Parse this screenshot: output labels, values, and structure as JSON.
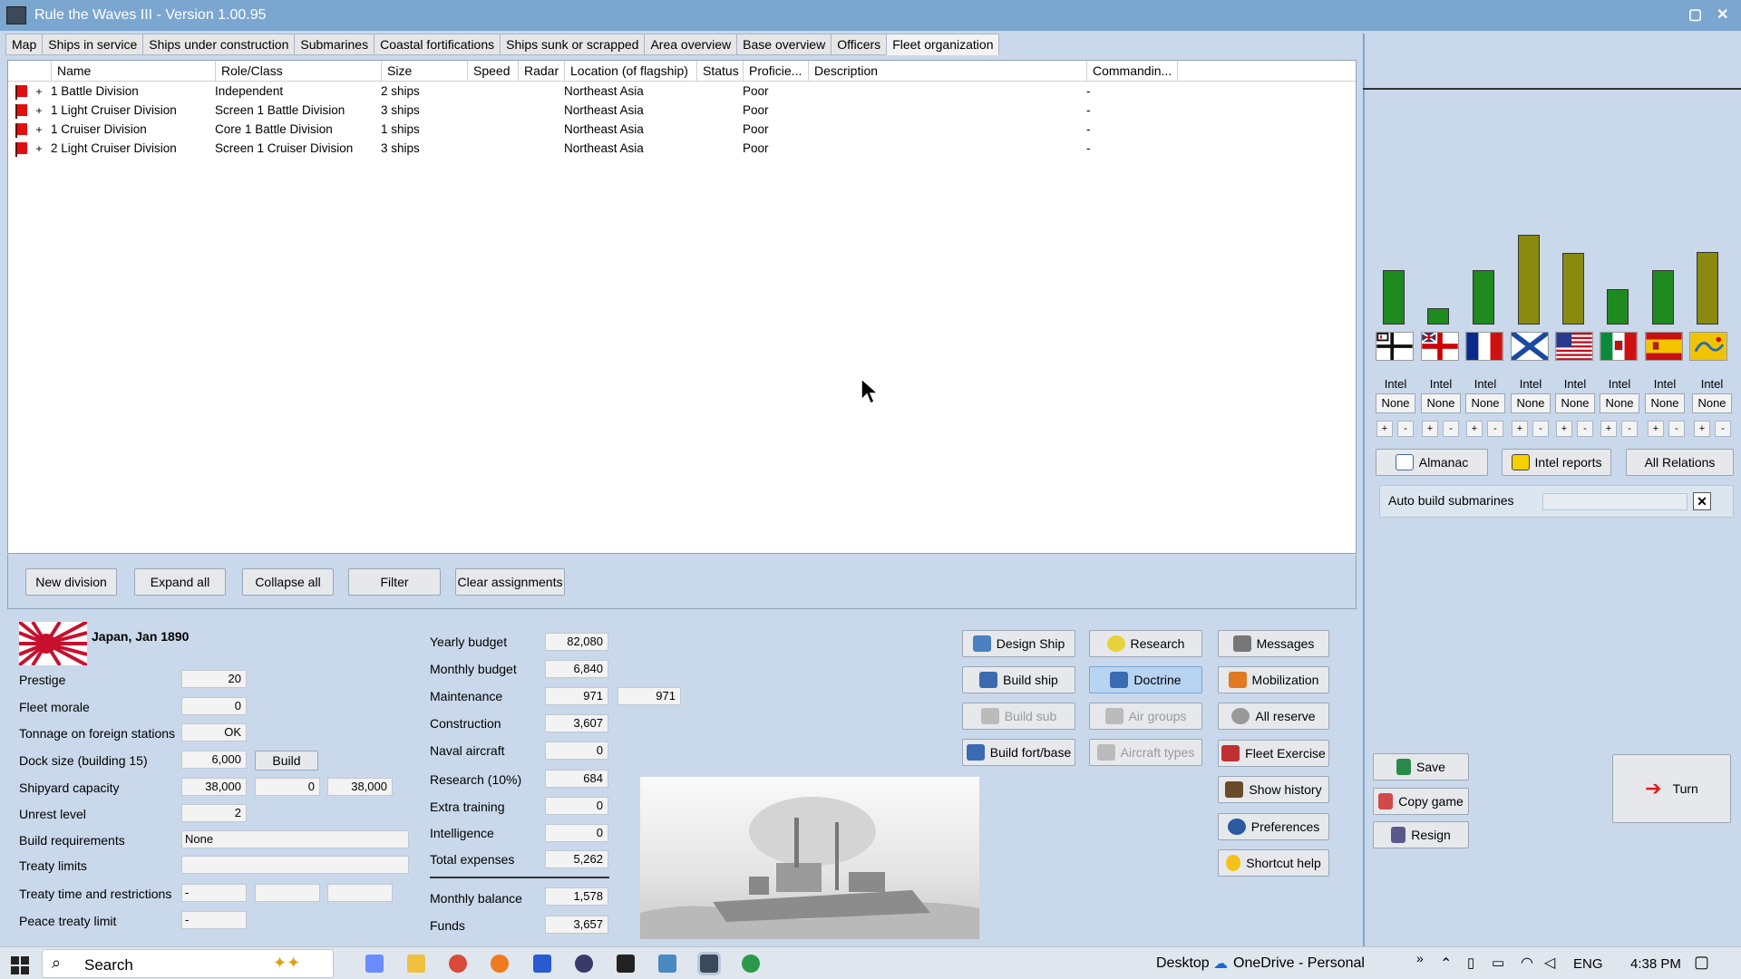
{
  "window": {
    "title": "Rule the Waves III - Version 1.00.95"
  },
  "tabs": [
    "Map",
    "Ships in service",
    "Ships under construction",
    "Submarines",
    "Coastal fortifications",
    "Ships sunk or scrapped",
    "Area overview",
    "Base overview",
    "Officers",
    "Fleet organization"
  ],
  "table": {
    "columns": [
      "Name",
      "Role/Class",
      "Size",
      "Speed",
      "Radar",
      "Location (of flagship)",
      "Status",
      "Proficie...",
      "Description",
      "Commandin..."
    ],
    "rows": [
      {
        "name": "1 Battle Division",
        "role": "Independent",
        "size": "2 ships",
        "location": "Northeast Asia",
        "proficiency": "Poor",
        "commander": "-"
      },
      {
        "name": "1 Light Cruiser Division",
        "role": "Screen 1 Battle Division",
        "size": "3 ships",
        "location": "Northeast Asia",
        "proficiency": "Poor",
        "commander": "-"
      },
      {
        "name": "1 Cruiser Division",
        "role": "Core 1 Battle Division",
        "size": "1 ships",
        "location": "Northeast Asia",
        "proficiency": "Poor",
        "commander": "-"
      },
      {
        "name": "2 Light Cruiser Division",
        "role": "Screen 1 Cruiser Division",
        "size": "3 ships",
        "location": "Northeast Asia",
        "proficiency": "Poor",
        "commander": "-"
      }
    ],
    "expander": "+"
  },
  "fleet_buttons": {
    "new_division": "New division",
    "expand_all": "Expand all",
    "collapse_all": "Collapse all",
    "filter": "Filter",
    "clear": "Clear assignments"
  },
  "nation": {
    "title": "Japan, Jan 1890",
    "prestige_label": "Prestige",
    "prestige": "20",
    "morale_label": "Fleet morale",
    "morale": "0",
    "tonnage_label": "Tonnage on foreign stations",
    "tonnage": "OK",
    "dock_label": "Dock size (building 15)",
    "dock": "6,000",
    "build_label": "Build",
    "shipyard_label": "Shipyard capacity",
    "shipyard_1": "38,000",
    "shipyard_2": "0",
    "shipyard_3": "38,000",
    "unrest_label": "Unrest level",
    "unrest": "2",
    "buildreq_label": "Build requirements",
    "buildreq": "None",
    "treaty_label": "Treaty limits",
    "treaty_time_label": "Treaty time and restrictions",
    "treaty_time_1": "-",
    "peace_label": "Peace treaty limit",
    "peace": "-"
  },
  "budget": {
    "yearly_label": "Yearly budget",
    "yearly": "82,080",
    "monthly_label": "Monthly budget",
    "monthly": "6,840",
    "maint_label": "Maintenance",
    "maint": "971",
    "maint2": "971",
    "constr_label": "Construction",
    "constr": "3,607",
    "aircraft_label": "Naval aircraft",
    "aircraft": "0",
    "research_label": "Research (10%)",
    "research": "684",
    "training_label": "Extra training",
    "training": "0",
    "intel_label": "Intelligence",
    "intel": "0",
    "total_label": "Total expenses",
    "total": "5,262",
    "balance_label": "Monthly balance",
    "balance": "1,578",
    "funds_label": "Funds",
    "funds": "3,657"
  },
  "actions": {
    "design_ship": "Design Ship",
    "research": "Research",
    "messages": "Messages",
    "build_ship": "Build ship",
    "doctrine": "Doctrine",
    "mobilization": "Mobilization",
    "build_sub": "Build sub",
    "air_groups": "Air groups",
    "all_reserve": "All reserve",
    "build_fort": "Build fort/base",
    "aircraft_types": "Aircraft types",
    "fleet_exercise": "Fleet Exercise",
    "show_history": "Show history",
    "preferences": "Preferences",
    "shortcut_help": "Shortcut help"
  },
  "intel": {
    "label": "Intel",
    "level": "None",
    "plus": "+",
    "minus": "-"
  },
  "nations_bars": [
    {
      "nation": "Germany",
      "value": 0.56,
      "color": "#1f8a1f"
    },
    {
      "nation": "Britain",
      "value": 0.17,
      "color": "#1f8a1f"
    },
    {
      "nation": "France",
      "value": 0.56,
      "color": "#1f8a1f"
    },
    {
      "nation": "Russia",
      "value": 1.0,
      "color": "#8a8a10"
    },
    {
      "nation": "USA",
      "value": 0.78,
      "color": "#8a8a10"
    },
    {
      "nation": "Italy",
      "value": 0.37,
      "color": "#1f8a1f"
    },
    {
      "nation": "Spain",
      "value": 0.6,
      "color": "#1f8a1f"
    },
    {
      "nation": "China",
      "value": 0.8,
      "color": "#8a8a10"
    }
  ],
  "right_buttons": {
    "almanac": "Almanac",
    "intel_reports": "Intel reports",
    "all_relations": "All Relations",
    "auto_build": "Auto build submarines",
    "save": "Save",
    "copy_game": "Copy game",
    "resign": "Resign",
    "turn": "Turn"
  },
  "taskbar": {
    "search": "Search",
    "desktop": "Desktop",
    "onedrive": "OneDrive - Personal",
    "lang": "ENG",
    "time": "4:38 PM"
  }
}
